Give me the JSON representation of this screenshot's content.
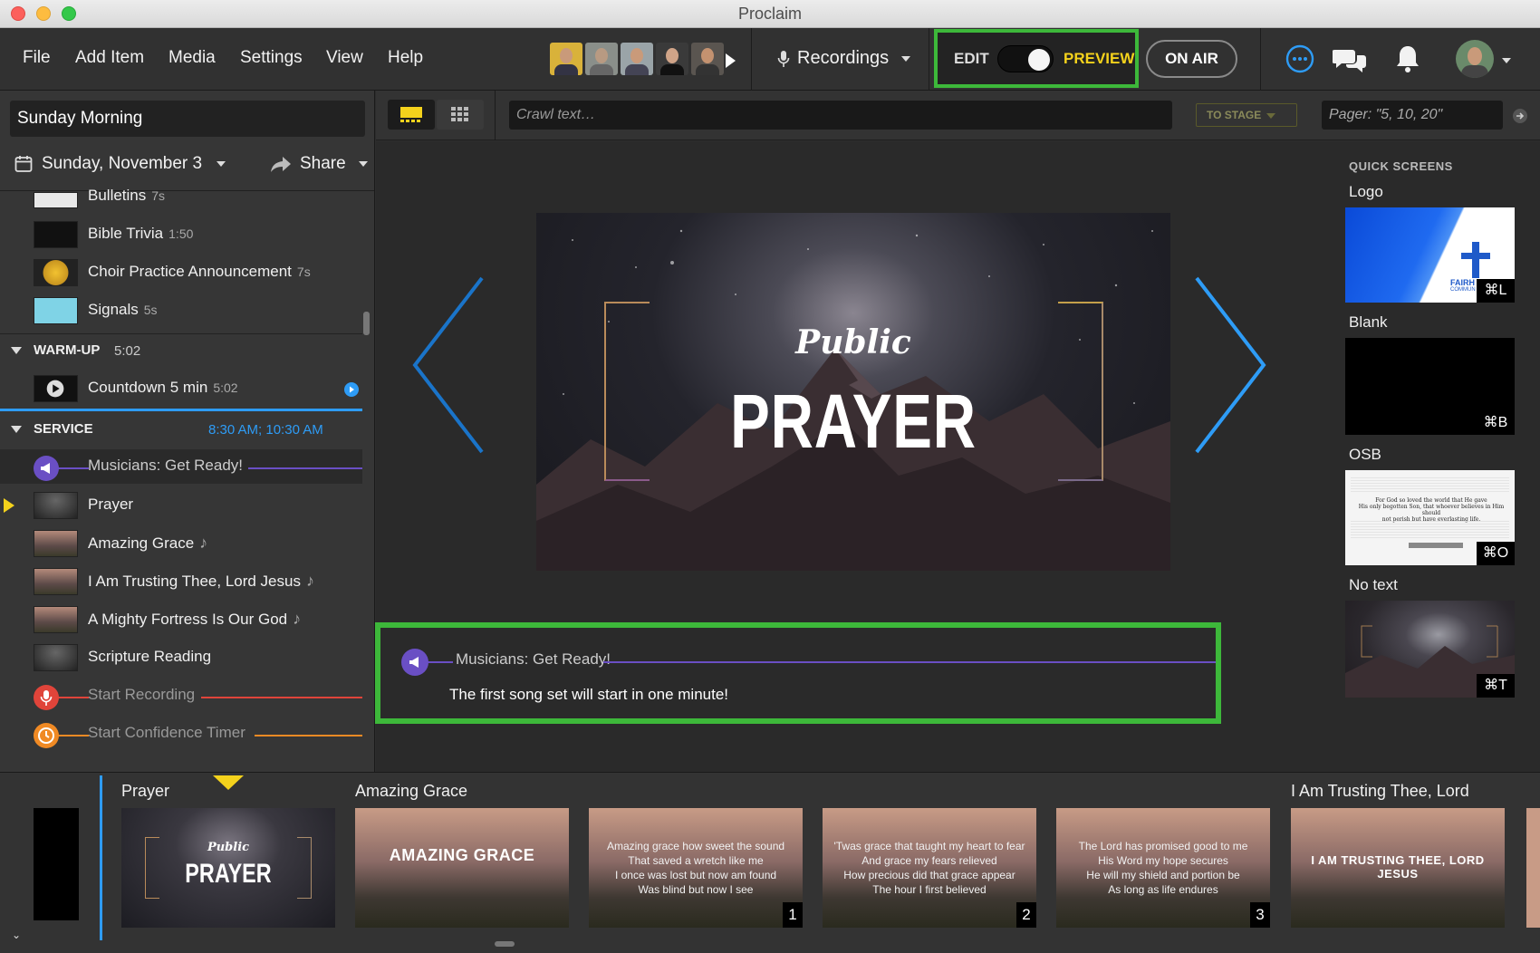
{
  "window": {
    "title": "Proclaim"
  },
  "menu": {
    "items": [
      "File",
      "Add Item",
      "Media",
      "Settings",
      "View",
      "Help"
    ]
  },
  "header": {
    "recordings_label": "Recordings",
    "edit_label": "EDIT",
    "preview_label": "PREVIEW",
    "mode": "preview",
    "onair_label": "ON AIR"
  },
  "plan": {
    "name": "Sunday Morning",
    "date": "Sunday, November 3",
    "share_label": "Share"
  },
  "items": [
    {
      "title": "Bulletins",
      "duration": "7s"
    },
    {
      "title": "Bible Trivia",
      "duration": "1:50"
    },
    {
      "title": "Choir Practice Announcement",
      "duration": "7s"
    },
    {
      "title": "Signals",
      "duration": "5s"
    }
  ],
  "warmup": {
    "title": "WARM-UP",
    "time": "5:02",
    "items": [
      {
        "title": "Countdown 5 min",
        "duration": "5:02"
      }
    ]
  },
  "service": {
    "title": "SERVICE",
    "time": "8:30 AM; 10:30 AM",
    "cue_musicians": "Musicians: Get Ready!",
    "items": [
      {
        "title": "Prayer",
        "note": ""
      },
      {
        "title": "Amazing Grace",
        "note": "♪"
      },
      {
        "title": "I Am Trusting Thee, Lord Jesus",
        "note": "♪"
      },
      {
        "title": "A Mighty Fortress Is Our God",
        "note": "♪"
      },
      {
        "title": "Scripture Reading",
        "note": ""
      }
    ],
    "cue_start_recording": "Start Recording",
    "cue_confidence_timer": "Start Confidence Timer"
  },
  "toolbar": {
    "crawl_placeholder": "Crawl text…",
    "to_stage_label": "TO STAGE",
    "pager_placeholder": "Pager: \"5, 10, 20\""
  },
  "slide": {
    "line1": "Public",
    "line2": "PRAYER"
  },
  "cue_panel": {
    "title": "Musicians: Get Ready!",
    "message": "The first song set will start in one minute!"
  },
  "quick_screens": {
    "heading": "QUICK SCREENS",
    "logo_text": "FAIRH",
    "logo_sub": "COMMUN",
    "items": [
      {
        "label": "Logo",
        "shortcut": "⌘L"
      },
      {
        "label": "Blank",
        "shortcut": "⌘B"
      },
      {
        "label": "OSB",
        "shortcut": "⌘O"
      },
      {
        "label": "No text",
        "shortcut": "⌘T"
      }
    ]
  },
  "osb_text": [
    "For God so loved the world that He gave",
    "His only begotten Son, that whoever believes in Him should",
    "not perish but have everlasting life."
  ],
  "bottom": {
    "labels": [
      "Prayer",
      "Amazing Grace",
      "I Am Trusting Thee, Lord"
    ],
    "slides": [
      {
        "line1": "Public",
        "line2": "PRAYER"
      },
      {
        "title": "AMAZING GRACE"
      },
      {
        "lyrics": "Amazing grace how sweet the sound\nThat saved a wretch like me\nI once was lost but now am found\nWas blind but now I see",
        "num": "1"
      },
      {
        "lyrics": "'Twas grace that taught my heart to fear\nAnd grace my fears relieved\nHow precious did that grace appear\nThe hour I first believed",
        "num": "2"
      },
      {
        "lyrics": "The Lord has promised good to me\nHis Word my hope secures\nHe will my shield and portion be\nAs long as life endures",
        "num": "3"
      },
      {
        "title": "I AM TRUSTING THEE, LORD JESUS"
      }
    ]
  },
  "colors": {
    "accent_blue": "#2e9cf6",
    "highlight_green": "#3db83a",
    "preview_yellow": "#f4d21c",
    "cue_purple": "#6a4fc4",
    "cue_red": "#e0443a",
    "cue_orange": "#f08a24"
  }
}
